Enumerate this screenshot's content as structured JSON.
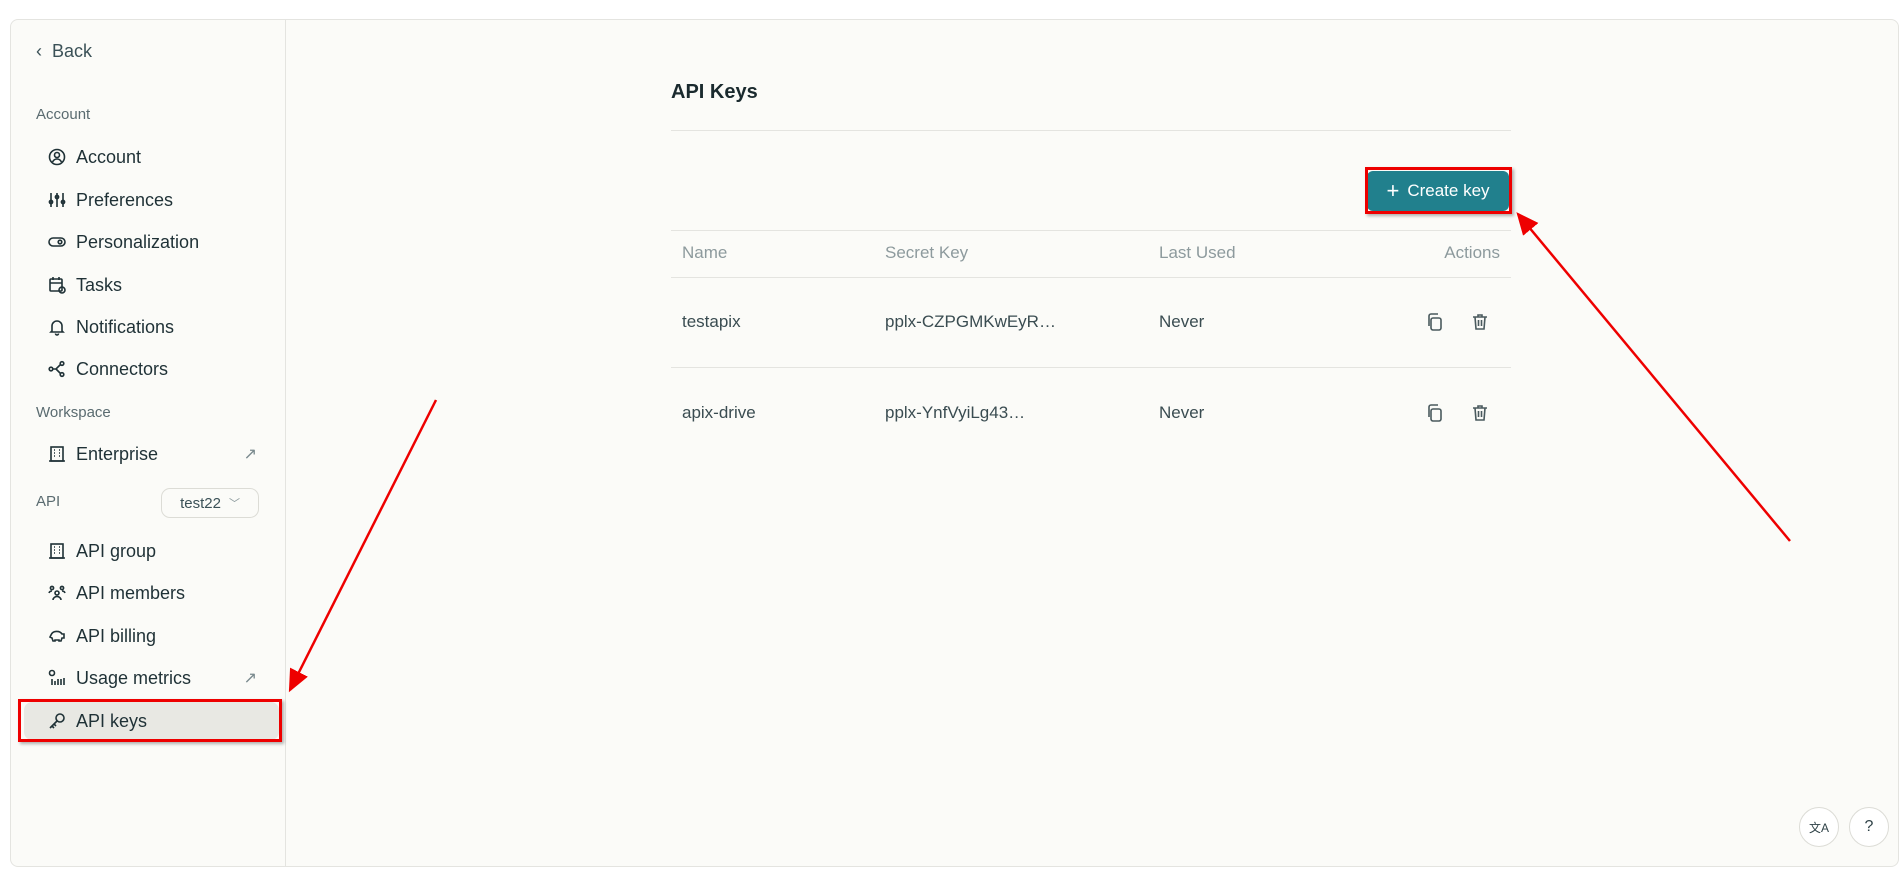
{
  "sidebar": {
    "back": "Back",
    "section_account": "Account",
    "section_workspace": "Workspace",
    "section_api": "API",
    "api_selector": "test22",
    "items": [
      {
        "label": "Account",
        "icon": "user-circle-icon"
      },
      {
        "label": "Preferences",
        "icon": "sliders-icon"
      },
      {
        "label": "Personalization",
        "icon": "toggle-icon"
      },
      {
        "label": "Tasks",
        "icon": "calendar-clock-icon"
      },
      {
        "label": "Notifications",
        "icon": "bell-icon"
      },
      {
        "label": "Connectors",
        "icon": "share-nodes-icon"
      },
      {
        "label": "Enterprise",
        "icon": "building-icon"
      },
      {
        "label": "API group",
        "icon": "building-icon"
      },
      {
        "label": "API members",
        "icon": "users-icon"
      },
      {
        "label": "API billing",
        "icon": "piggy-bank-icon"
      },
      {
        "label": "Usage metrics",
        "icon": "chart-icon"
      },
      {
        "label": "API keys",
        "icon": "key-icon"
      }
    ]
  },
  "main": {
    "title": "API Keys",
    "create_button": "Create key",
    "columns": [
      "Name",
      "Secret Key",
      "Last Used",
      "Actions"
    ],
    "rows": [
      {
        "name": "testapix",
        "key": "pplx-CZPGMKwEyR…",
        "last_used": "Never"
      },
      {
        "name": "apix-drive",
        "key": "pplx-YnfVyiLg43…",
        "last_used": "Never"
      }
    ]
  },
  "footer": {
    "translate": "文A",
    "help": "?"
  },
  "colors": {
    "accent": "#21808d",
    "annotation": "#ee0000"
  }
}
